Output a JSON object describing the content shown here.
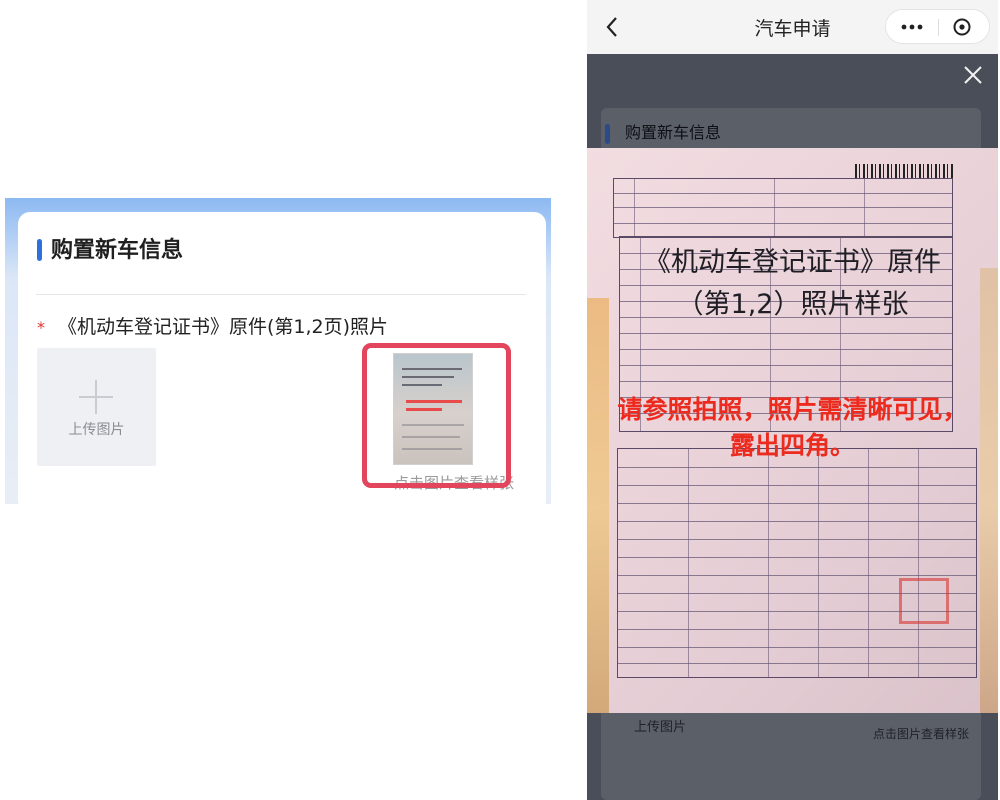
{
  "left": {
    "section_title": "购置新车信息",
    "field_label": "《机动车登记证书》原件(第1,2页)照片",
    "required_mark": "*",
    "upload_label": "上传图片",
    "sample_caption": "点击图片查看样张"
  },
  "right": {
    "nav": {
      "title": "汽车申请"
    },
    "section_title": "购置新车信息",
    "sample": {
      "heading": "《机动车登记证书》原件\n（第1,2）照片样张",
      "instruction": "请参照拍照，照片需清晰可见，\n露出四角。"
    },
    "under_upload_label": "上传图片",
    "under_sample_caption": "点击图片查看样张"
  },
  "colors": {
    "accent": "#2f6fde",
    "highlight": "#e2455c",
    "instruction_red": "#ec2a1e"
  }
}
